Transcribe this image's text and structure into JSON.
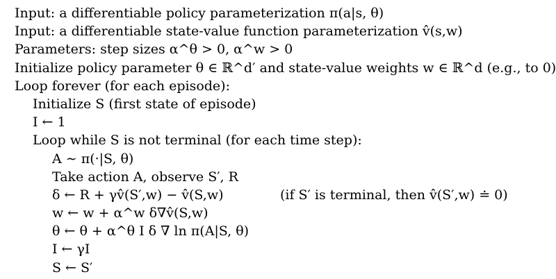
{
  "algorithm": {
    "lines": [
      {
        "text": "Input: a differentiable policy parameterization π(a|s, θ)",
        "indent": 0
      },
      {
        "text": "Input: a differentiable state-value function parameterization v̂(s,w)",
        "indent": 0
      },
      {
        "text": "Parameters: step sizes α^θ > 0, α^w > 0",
        "indent": 0
      },
      {
        "text": "Initialize policy parameter θ ∈ ℝ^d′ and state-value weights w ∈ ℝ^d (e.g., to 0)",
        "indent": 0
      },
      {
        "text": "Loop forever (for each episode):",
        "indent": 0
      },
      {
        "text": "Initialize S (first state of episode)",
        "indent": 1
      },
      {
        "text": "I ← 1",
        "indent": 1
      },
      {
        "text": "Loop while S is not terminal (for each time step):",
        "indent": 1
      },
      {
        "text": "A ∼ π(·|S, θ)",
        "indent": 2
      },
      {
        "text": "Take action A, observe S′, R",
        "indent": 2
      },
      {
        "text": "δ ← R + γv̂(S′,w) − v̂(S,w)",
        "indent": 2,
        "comment": "(if S′ is terminal, then v̂(S′,w) ≐ 0)"
      },
      {
        "text": "w ← w + α^w δ∇v̂(S,w)",
        "indent": 2
      },
      {
        "text": "θ ← θ + α^θ I δ ∇ ln π(A|S, θ)",
        "indent": 2
      },
      {
        "text": "I ← γI",
        "indent": 2
      },
      {
        "text": "S ← S′",
        "indent": 2
      }
    ]
  }
}
